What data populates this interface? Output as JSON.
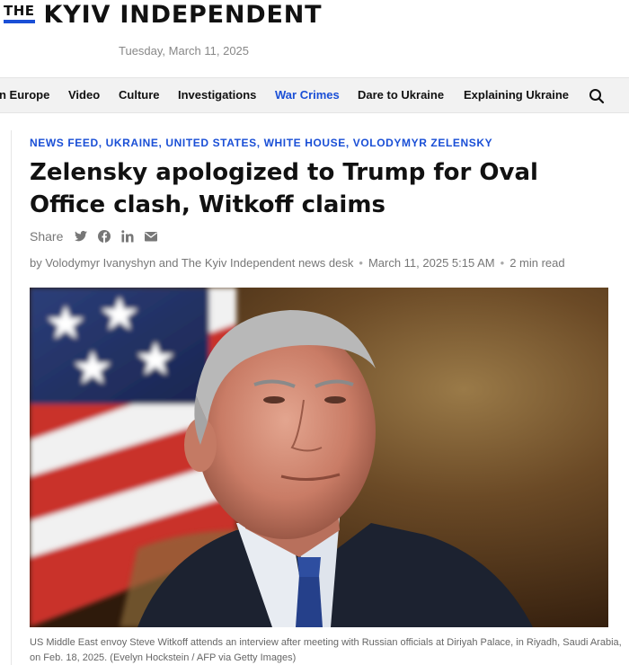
{
  "header": {
    "logo_the": "THE",
    "logo_name": "KYIV INDEPENDENT",
    "date": "Tuesday, March 11, 2025",
    "accent_color": "#1a4fd6"
  },
  "nav": {
    "items": [
      {
        "label": "n Europe"
      },
      {
        "label": "Video"
      },
      {
        "label": "Culture"
      },
      {
        "label": "Investigations"
      },
      {
        "label": "War Crimes",
        "active": true
      },
      {
        "label": "Dare to Ukraine"
      },
      {
        "label": "Explaining Ukraine"
      }
    ],
    "search_icon": "search-icon"
  },
  "article": {
    "tags": [
      "NEWS FEED",
      "UKRAINE",
      "UNITED STATES",
      "WHITE HOUSE",
      "VOLODYMYR ZELENSKY"
    ],
    "tag_separator": ", ",
    "headline": "Zelensky apologized to Trump for Oval Office clash, Witkoff claims",
    "share_label": "Share",
    "share_icons": [
      "twitter-icon",
      "facebook-icon",
      "linkedin-icon",
      "email-icon"
    ],
    "byline": {
      "authors": "by Volodymyr Ivanyshyn and The Kyiv Independent news desk",
      "date": "March 11, 2025 5:15 AM",
      "read_time": "2 min read",
      "separator": "•"
    },
    "image_description_icon": "portrait-photo",
    "caption": "US Middle East envoy Steve Witkoff attends an interview after meeting with Russian officials at Diriyah Palace, in Riyadh, Saudi Arabia, on Feb. 18, 2025. (Evelyn Hockstein / AFP via Getty Images)"
  }
}
